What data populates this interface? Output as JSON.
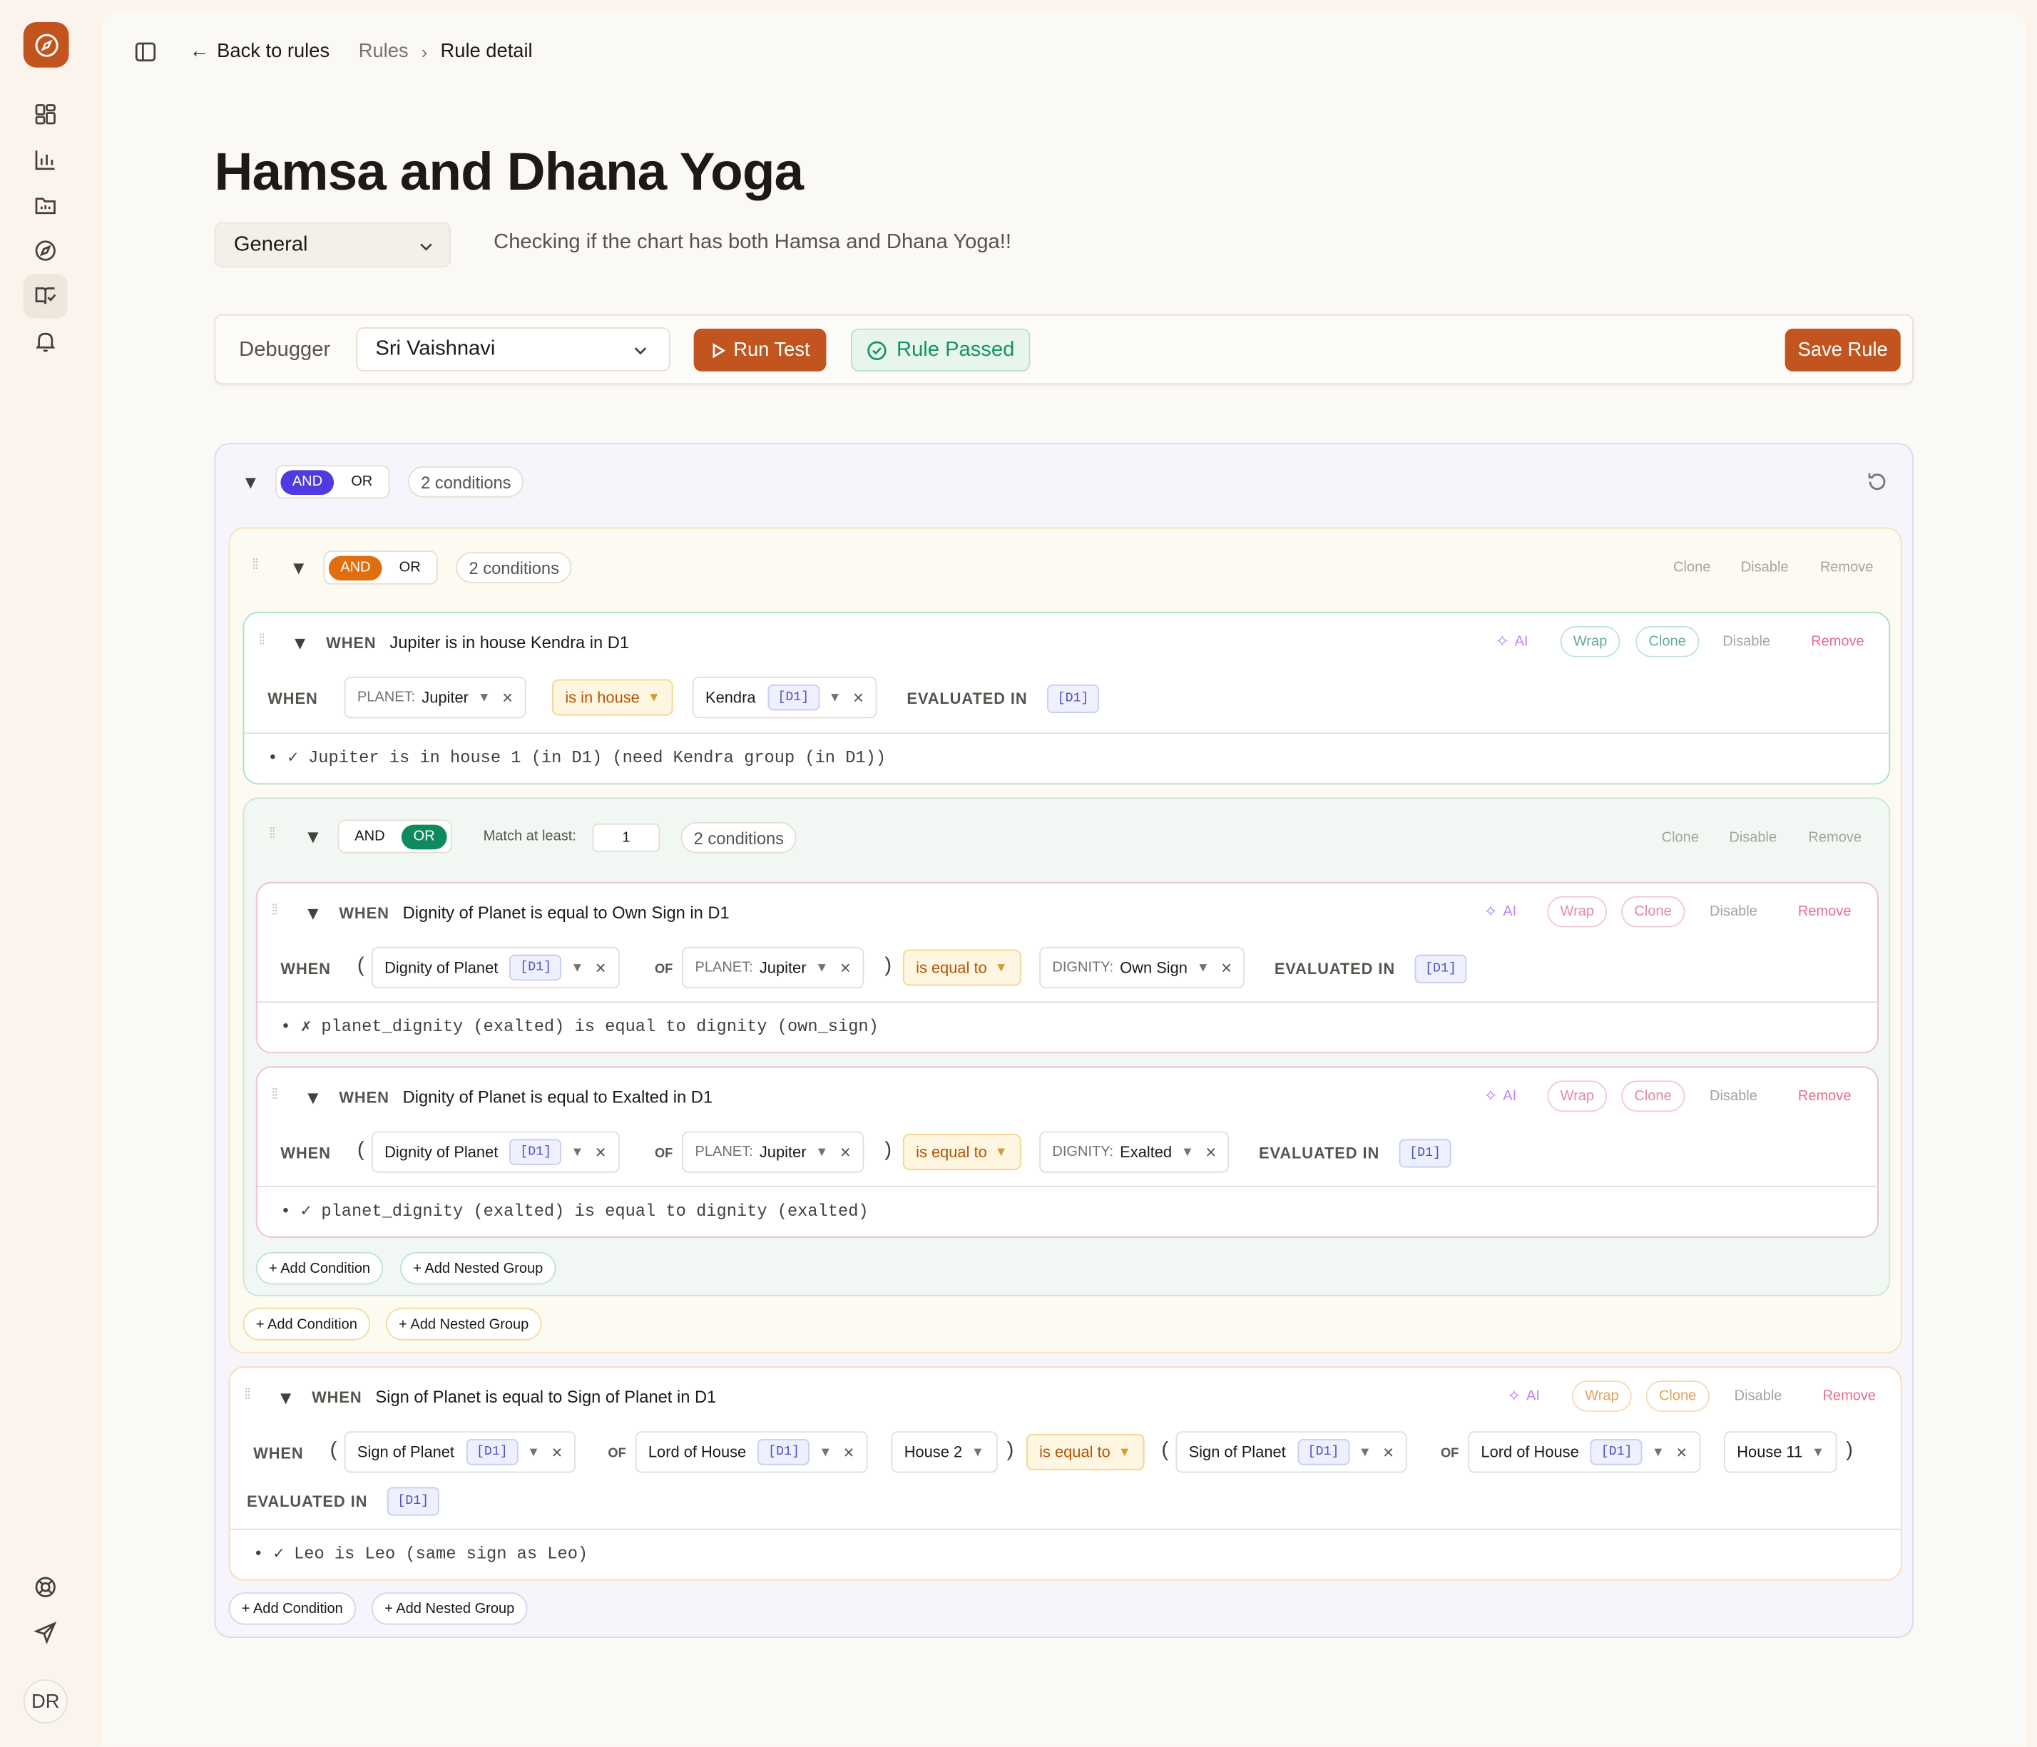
{
  "sidebar": {
    "avatar_initials": "DR",
    "icons": [
      "logo-compass-icon",
      "dashboard-icon",
      "chart-icon",
      "folder-icon",
      "compass-icon",
      "book-check-icon",
      "bell-icon",
      "lifebuoy-icon",
      "send-icon"
    ]
  },
  "topbar": {
    "back_label": "Back to rules",
    "breadcrumb_root": "Rules",
    "breadcrumb_current": "Rule detail"
  },
  "rule": {
    "title": "Hamsa and Dhana Yoga",
    "category": "General",
    "description": "Checking if the chart has both Hamsa and Dhana Yoga!!"
  },
  "debugger": {
    "label": "Debugger",
    "subject": "Sri Vaishnavi",
    "run_label": "Run Test",
    "status": "Rule Passed",
    "save_label": "Save Rule"
  },
  "labels": {
    "and": "AND",
    "or": "OR",
    "when": "WHEN",
    "of": "OF",
    "evaluated_in": "EVALUATED IN",
    "ai": "AI",
    "wrap": "Wrap",
    "clone": "Clone",
    "disable": "Disable",
    "remove": "Remove",
    "add_condition": "+ Add Condition",
    "add_nested_group": "+ Add Nested Group",
    "match_at_least": "Match at least:",
    "d1": "[D1]"
  },
  "root": {
    "count": "2 conditions"
  },
  "group1": {
    "count": "2 conditions"
  },
  "cond1": {
    "title": "Jupiter is in house Kendra in D1",
    "planet_label": "PLANET:",
    "planet": "Jupiter",
    "operator": "is in house",
    "house": "Kendra",
    "trace": "• ✓ Jupiter is in house 1 (in D1) (need Kendra group (in D1))"
  },
  "group2": {
    "count": "2 conditions",
    "match_value": "1"
  },
  "cond2": {
    "title": "Dignity of Planet is equal to Own Sign in D1",
    "fn": "Dignity of Planet",
    "planet_label": "PLANET:",
    "planet": "Jupiter",
    "operator": "is equal to",
    "dignity_label": "DIGNITY:",
    "dignity": "Own Sign",
    "trace": "• ✗ planet_dignity (exalted) is equal to dignity (own_sign)"
  },
  "cond3": {
    "title": "Dignity of Planet is equal to Exalted in D1",
    "fn": "Dignity of Planet",
    "planet_label": "PLANET:",
    "planet": "Jupiter",
    "operator": "is equal to",
    "dignity_label": "DIGNITY:",
    "dignity": "Exalted",
    "trace": "• ✓ planet_dignity (exalted) is equal to dignity (exalted)"
  },
  "cond4": {
    "title": "Sign of Planet is equal to Sign of Planet in D1",
    "fn": "Sign of Planet",
    "lord": "Lord of House",
    "house_a": "House 2",
    "operator": "is equal to",
    "fn_b": "Sign of Planet",
    "lord_b": "Lord of House",
    "house_b": "House 11",
    "trace": "• ✓ Leo is Leo (same sign as Leo)"
  },
  "colors": {
    "accent": "#c2541f",
    "and_active": "#4f3be0",
    "or_active": "#0f8a5f",
    "group_and": "#e06d0e",
    "pass": "#159364"
  }
}
